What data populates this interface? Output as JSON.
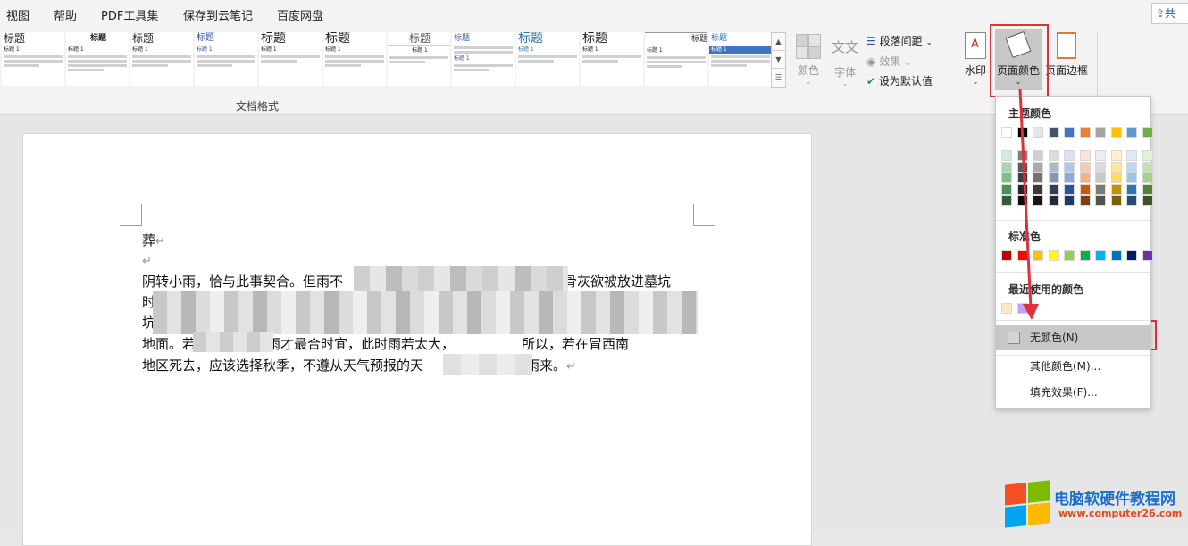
{
  "menubar": {
    "items": [
      "视图",
      "帮助",
      "PDF工具集",
      "保存到云笔记",
      "百度网盘"
    ],
    "share_label": "共"
  },
  "ribbon": {
    "style_gallery": [
      {
        "heading": "标题",
        "sub": "标题 1"
      },
      {
        "heading": "标题",
        "sub": "标题 1"
      },
      {
        "heading": "标题",
        "sub": "标题 1"
      },
      {
        "heading": "标题",
        "sub": "标题 1"
      },
      {
        "heading": "标题",
        "sub": "标题 1"
      },
      {
        "heading": "标题",
        "sub": "标题 1"
      },
      {
        "heading": "标题",
        "sub": "标题 1"
      },
      {
        "heading": "标题",
        "sub": "标题 1"
      },
      {
        "heading": "标题",
        "sub": "标题 1"
      },
      {
        "heading": "标题",
        "sub": "标题 1"
      },
      {
        "heading": "标题",
        "sub": "标题 1"
      },
      {
        "heading": "标题",
        "sub": "标题 1"
      }
    ],
    "group_label": "文档格式",
    "colors_label": "颜色",
    "fonts_label": "字体",
    "fonts_icon_text": "文文",
    "paragraph_spacing_label": "段落间距",
    "effects_label": "效果",
    "set_default_label": "设为默认值",
    "watermark_label": "水印",
    "page_color_label": "页面颜色",
    "page_borders_label": "页面边框"
  },
  "document": {
    "line1": "葬",
    "line3_a": "阴转小雨，恰与此事契合。但雨不",
    "line3_b": "或骨灰欲被放进墓坑",
    "line4_a": "时",
    "line5_a": "坑，当然",
    "line6_a": "地面。若",
    "line6_b": "雨才最合时宜，此时雨若太大，",
    "line6_c": "所以，若在冒西南",
    "line7_a": "地区死去，应该选择秋季，不遵从天气预报的天",
    "line7_b": "下雨来。"
  },
  "dropdown": {
    "theme_colors_label": "主题颜色",
    "standard_colors_label": "标准色",
    "recent_colors_label": "最近使用的颜色",
    "no_color_label": "无颜色(N)",
    "more_colors_label": "其他颜色(M)...",
    "fill_effects_label": "填充效果(F)...",
    "theme_top_row": [
      "#ffffff",
      "#000000",
      "#e7e6e6",
      "#44546a",
      "#4472c4",
      "#ed7d31",
      "#a5a5a5",
      "#ffc000",
      "#5b9bd5",
      "#70ad47"
    ],
    "theme_shades": [
      [
        "#d5ebd9",
        "#a9d5b2",
        "#7dbf8b",
        "#4f8f5c",
        "#2f5f3a"
      ],
      [
        "#7f7f7f",
        "#595959",
        "#3f3f3f",
        "#262626",
        "#0c0c0c"
      ],
      [
        "#d0cece",
        "#aeaaaa",
        "#757171",
        "#3a3838",
        "#171616"
      ],
      [
        "#d6dce4",
        "#adb9ca",
        "#8497b0",
        "#333f4f",
        "#222a35"
      ],
      [
        "#d9e2f3",
        "#b4c6e7",
        "#8eaadb",
        "#2f5496",
        "#1f3864"
      ],
      [
        "#fbe5d5",
        "#f7cbac",
        "#f4b183",
        "#c55a11",
        "#833c0b"
      ],
      [
        "#ededed",
        "#dbdbdb",
        "#c9c9c9",
        "#7b7b7b",
        "#525252"
      ],
      [
        "#fff2cc",
        "#ffe599",
        "#ffd966",
        "#bf9000",
        "#7f6000"
      ],
      [
        "#deebf6",
        "#bdd7ee",
        "#9dc3e6",
        "#2e75b5",
        "#1f4e79"
      ],
      [
        "#e2efd9",
        "#c5e0b3",
        "#a8d08d",
        "#538135",
        "#375623"
      ]
    ],
    "standard_colors": [
      "#c00000",
      "#ff0000",
      "#ffc000",
      "#ffff00",
      "#92d050",
      "#00b050",
      "#00b0f0",
      "#0070c0",
      "#002060",
      "#7030a0"
    ],
    "recent_colors": [
      "#fde9c7",
      "#c59ff5"
    ]
  },
  "watermark": {
    "title": "电脑软硬件教程网",
    "url": "www.computer26.com"
  },
  "colors": {
    "accent_red": "#e0303a",
    "ribbon_bg": "#f3f3f3",
    "document_bg": "#e6e6e6"
  }
}
